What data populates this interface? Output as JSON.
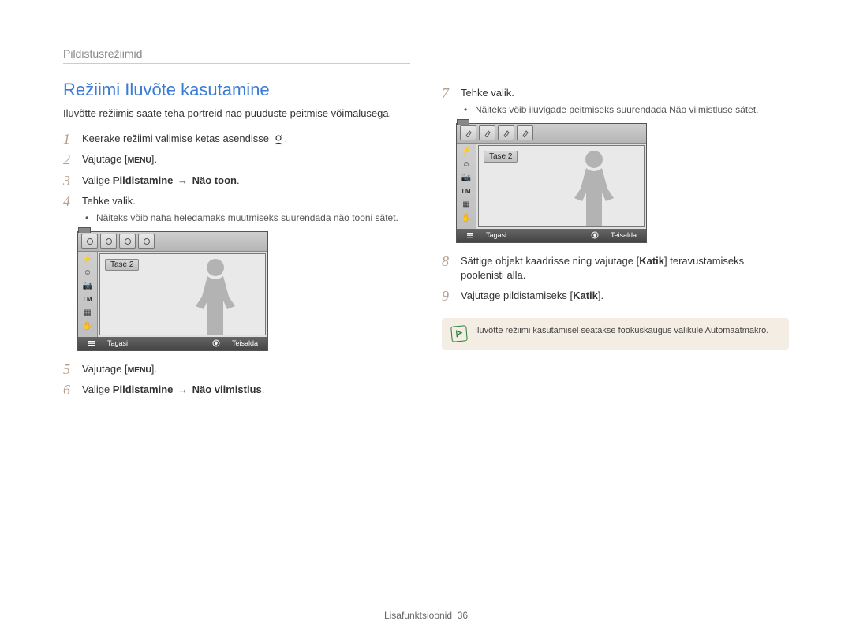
{
  "header": "Pildistusrežiimid",
  "title": "Režiimi Iluvõte kasutamine",
  "intro": "Iluvõtte režiimis saate teha portreid näo puuduste peitmise võimalusega.",
  "left": {
    "step1": "Keerake režiimi valimise ketas asendisse",
    "step2_pre": "Vajutage [",
    "step2_post": "].",
    "menu_label": "MENU",
    "step3_pre": "Valige ",
    "step3_b1": "Pildistamine",
    "arrow": "→",
    "step3_b2": "Näo toon",
    "step4": "Tehke valik.",
    "step4_sub": "Näiteks võib naha heledamaks muutmiseks suurendada näo tooni sätet.",
    "step5_pre": "Vajutage [",
    "step5_post": "].",
    "step6_pre": "Valige ",
    "step6_b1": "Pildistamine",
    "step6_b2": "Näo viimistlus"
  },
  "right": {
    "step7": "Tehke valik.",
    "step7_sub": "Näiteks võib iluvigade peitmiseks suurendada Näo viimistluse sätet.",
    "step8_pre": "Sättige objekt kaadrisse ning vajutage [",
    "step8_b": "Katik",
    "step8_post": "] teravustamiseks poolenisti alla.",
    "step9_pre": "Vajutage pildistamiseks [",
    "step9_b": "Katik",
    "step9_post": "]."
  },
  "camera_ui": {
    "level": "Tase 2",
    "back_icon_label": "MENU",
    "back": "Tagasi",
    "move": "Teisalda"
  },
  "note": "Iluvõtte režiimi kasutamisel seatakse fookuskaugus valikule Automaatmakro.",
  "footer_text": "Lisafunktsioonid",
  "footer_page": "36",
  "nums": {
    "n1": "1",
    "n2": "2",
    "n3": "3",
    "n4": "4",
    "n5": "5",
    "n6": "6",
    "n7": "7",
    "n8": "8",
    "n9": "9"
  }
}
